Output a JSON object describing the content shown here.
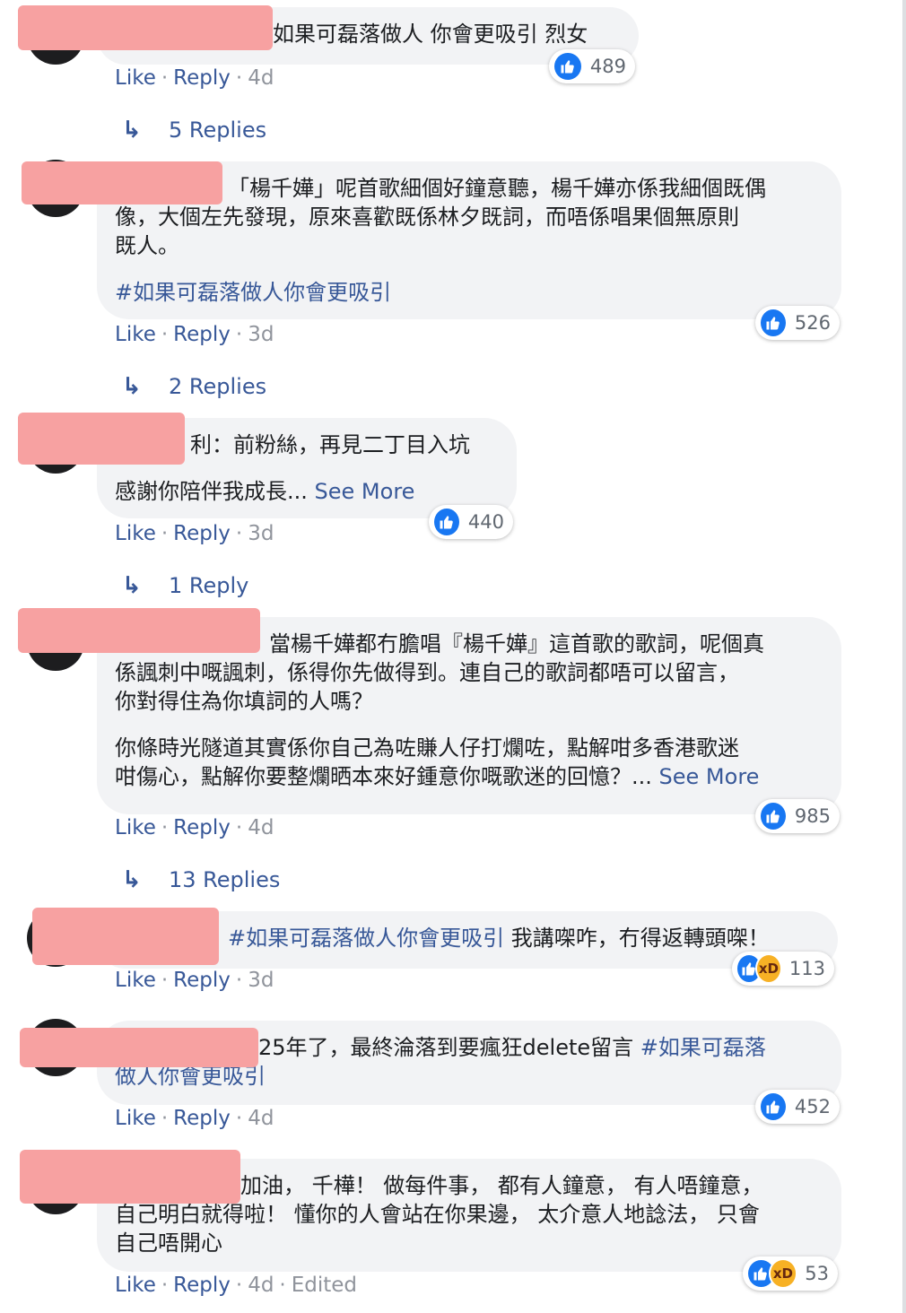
{
  "comments": [
    {
      "lines": [
        "如果可磊落做人 你會更吸引 烈女"
      ],
      "reactions": {
        "count": "489",
        "types": [
          "like-icon"
        ]
      },
      "meta": {
        "like": "Like",
        "reply": "Reply",
        "time": "4d"
      },
      "replies_label": "5 Replies"
    },
    {
      "lines": [
        "「楊千嬅」呢首歌細個好鐘意聽，楊千嬅亦係我細個既偶",
        "像，大個左先發現，原來喜歡既係林夕既詞，而唔係唱果個無原則",
        "既人。"
      ],
      "hashtag": "#如果可磊落做人你會更吸引",
      "reactions": {
        "count": "526",
        "types": [
          "like-icon"
        ]
      },
      "meta": {
        "like": "Like",
        "reply": "Reply",
        "time": "3d"
      },
      "replies_label": "2 Replies"
    },
    {
      "lines": [
        "利：前粉絲，再見二丁目入坑"
      ],
      "body": "感謝你陪伴我成長...",
      "see_more": "See More",
      "reactions": {
        "count": "440",
        "types": [
          "like-icon"
        ]
      },
      "meta": {
        "like": "Like",
        "reply": "Reply",
        "time": "3d"
      },
      "replies_label": "1 Reply"
    },
    {
      "lines": [
        "當楊千嬅都冇膽唱『楊千嬅』這首歌的歌詞，呢個真",
        "係諷刺中嘅諷刺，係得你先做得到。連自己的歌詞都唔可以留言，",
        "你對得住為你填詞的人嗎？"
      ],
      "para2": [
        "你條時光隧道其實係你自己為咗賺人仔打爛咗，點解咁多香港歌迷",
        "咁傷心，點解你要整爛晒本來好鍾意你嘅歌迷的回憶？..."
      ],
      "see_more": "See More",
      "reactions": {
        "count": "985",
        "types": [
          "like-icon"
        ]
      },
      "meta": {
        "like": "Like",
        "reply": "Reply",
        "time": "4d"
      },
      "replies_label": "13 Replies"
    },
    {
      "hashtag": "#如果可磊落做人你會更吸引",
      "text": " 我講㗎咋，冇得返轉頭㗎！",
      "reactions": {
        "count": "113",
        "types": [
          "like-icon",
          "haha-icon"
        ]
      },
      "meta": {
        "like": "Like",
        "reply": "Reply",
        "time": "3d"
      }
    },
    {
      "text": "25年了，最終淪落到要瘋狂delete留言 ",
      "hashtag": "#如果可磊落",
      "hashtag2": "做人你會更吸引",
      "reactions": {
        "count": "452",
        "types": [
          "like-icon"
        ]
      },
      "meta": {
        "like": "Like",
        "reply": "Reply",
        "time": "4d"
      }
    },
    {
      "lines": [
        "加油， 千樺！ 做每件事， 都有人鐘意， 有人唔鐘意，",
        "自己明白就得啦！ 懂你的人會站在你果邊， 太介意人地諗法， 只會",
        "自己唔開心"
      ],
      "reactions": {
        "count": "53",
        "types": [
          "like-icon",
          "haha-icon"
        ]
      },
      "meta": {
        "like": "Like",
        "reply": "Reply",
        "time": "4d",
        "edited": "Edited"
      }
    }
  ],
  "colors": {
    "link": "#385898",
    "bubble": "#f2f3f5",
    "meta_gray": "#90949c",
    "like_blue": "#1877f2",
    "redaction": "#f7a1a1"
  }
}
